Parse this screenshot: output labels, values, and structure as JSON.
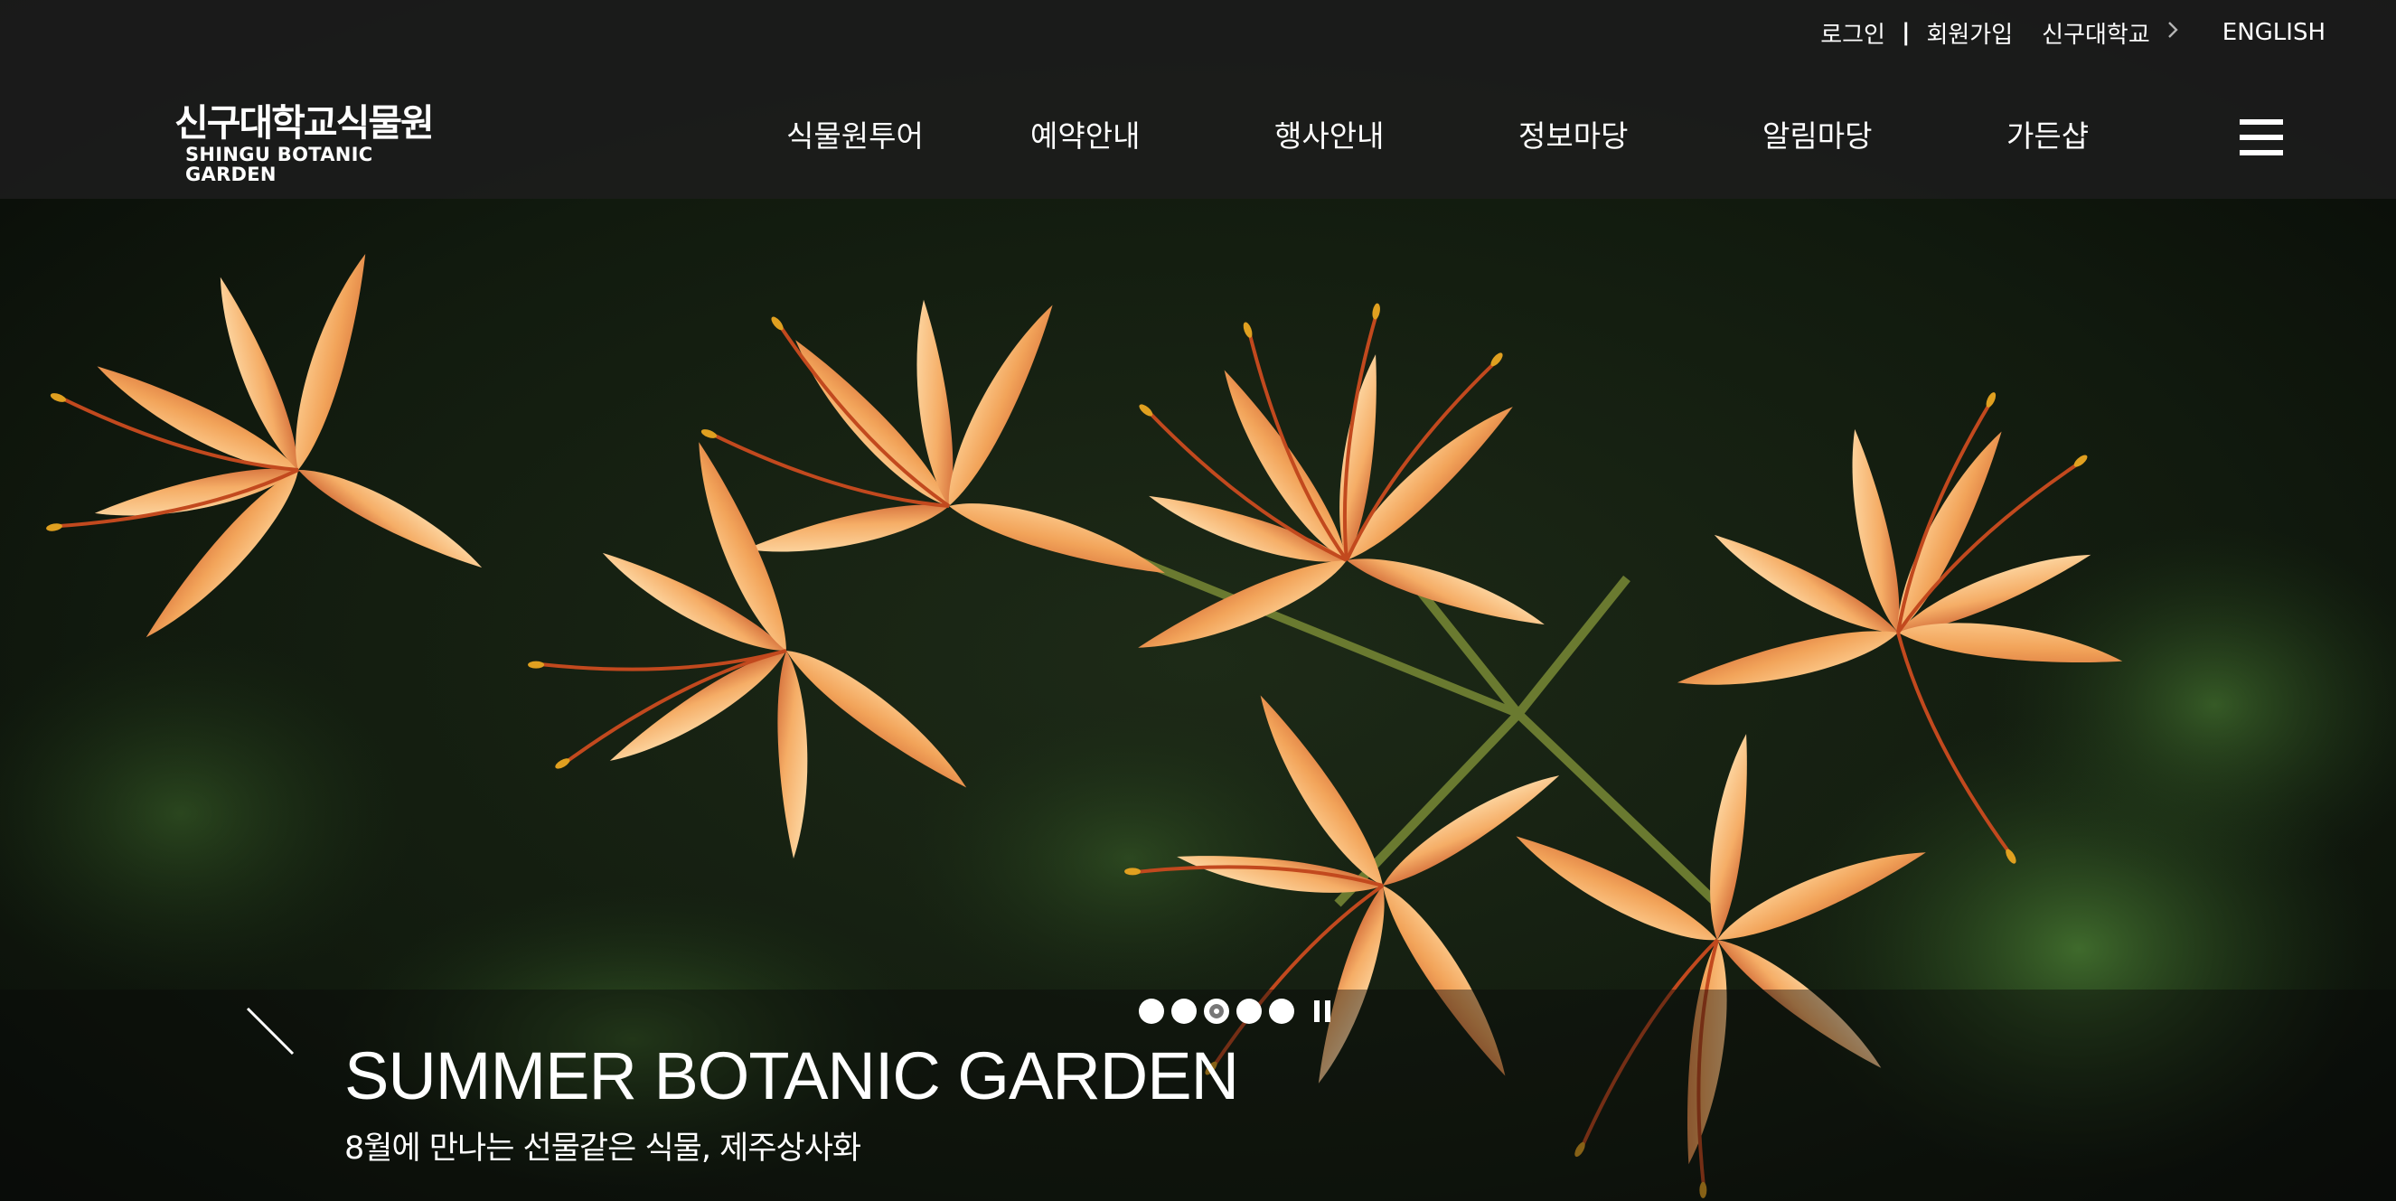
{
  "util_nav": {
    "login": "로그인",
    "separator": "|",
    "join": "회원가입",
    "university": "신구대학교",
    "english": "ENGLISH"
  },
  "logo": {
    "korean": "신구대학교식물원",
    "english": "SHINGU BOTANIC GARDEN"
  },
  "main_nav": [
    "식물원투어",
    "예약안내",
    "행사안내",
    "정보마당",
    "알림마당",
    "가든샵"
  ],
  "slider": {
    "title": "SUMMER BOTANIC GARDEN",
    "subtitle": "8월에 만나는 선물같은 식물, 제주상사화",
    "slide_count": 5,
    "active_slide": 3
  },
  "icons": {
    "menu": "hamburger-menu-icon",
    "chevron": "chevron-right-icon",
    "pause": "pause-icon",
    "slash": "slash-decoration-icon"
  },
  "colors": {
    "header_bg": "#1c1c1c",
    "text": "#ffffff",
    "flower_petal": "#f0a85a",
    "foliage": "#24401e"
  }
}
